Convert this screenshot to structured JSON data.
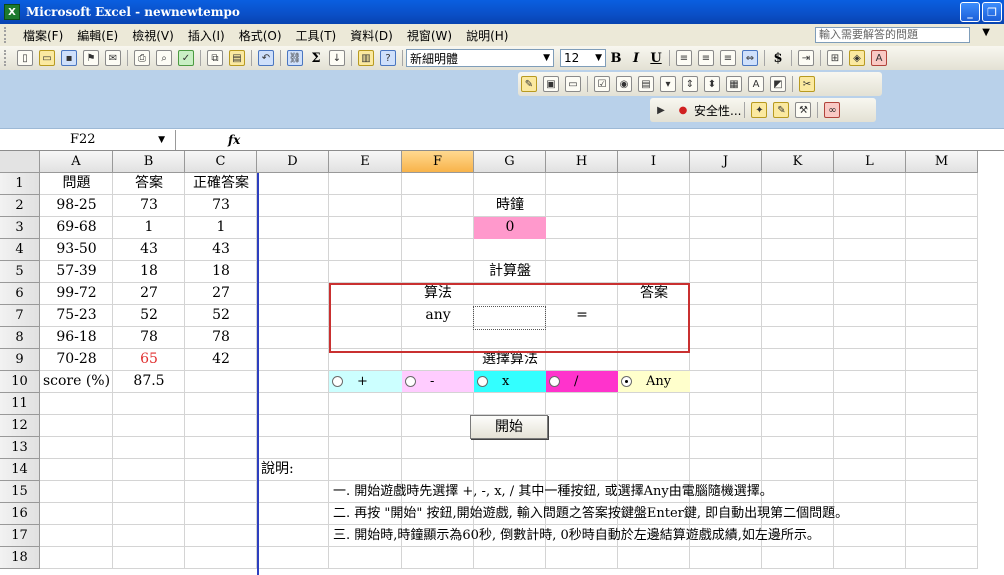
{
  "window": {
    "title": "Microsoft Excel - newnewtempo",
    "app_icon": "X"
  },
  "menu": {
    "items": [
      "檔案(F)",
      "編輯(E)",
      "檢視(V)",
      "插入(I)",
      "格式(O)",
      "工具(T)",
      "資料(D)",
      "視窗(W)",
      "說明(H)"
    ],
    "help_placeholder": "輸入需要解答的問題"
  },
  "toolbar": {
    "font_name": "新細明體",
    "font_size": "12",
    "bold": "B",
    "italic": "I",
    "underline": "U",
    "sum": "Σ",
    "currency": "$",
    "security_label": "安全性..."
  },
  "formula_bar": {
    "name_box": "F22",
    "fx": "fx"
  },
  "grid": {
    "columns": [
      "A",
      "B",
      "C",
      "D",
      "E",
      "F",
      "G",
      "H",
      "I",
      "J",
      "K",
      "L",
      "M"
    ],
    "selected_column": "F",
    "rows": [
      "1",
      "2",
      "3",
      "4",
      "5",
      "6",
      "7",
      "8",
      "9",
      "10",
      "11",
      "12",
      "13",
      "14",
      "15",
      "16",
      "17",
      "18"
    ]
  },
  "table": {
    "headers": [
      "問題",
      "答案",
      "正確答案"
    ],
    "rows": [
      [
        "98-25",
        "73",
        "73"
      ],
      [
        "69-68",
        "1",
        "1"
      ],
      [
        "93-50",
        "43",
        "43"
      ],
      [
        "57-39",
        "18",
        "18"
      ],
      [
        "99-72",
        "27",
        "27"
      ],
      [
        "75-23",
        "52",
        "52"
      ],
      [
        "96-18",
        "78",
        "78"
      ],
      [
        "70-28",
        "65",
        "42"
      ]
    ],
    "wrong_answer_color": "#e03030",
    "score_label": "score (%)",
    "score_value": "87.5"
  },
  "clock": {
    "label": "時鐘",
    "value": "0",
    "color": "#ff99cc"
  },
  "calculator": {
    "label": "計算盤",
    "method_label": "算法",
    "answer_label": "答案",
    "method_value": "any",
    "equals": "="
  },
  "operators": {
    "label": "選擇算法",
    "options": [
      {
        "label": "+",
        "color": "#ccffff"
      },
      {
        "label": "-",
        "color": "#ffccff"
      },
      {
        "label": "x",
        "color": "#33ffff"
      },
      {
        "label": "/",
        "color": "#ff33cc"
      },
      {
        "label": "Any",
        "color": "#ffffcc",
        "selected": true
      }
    ]
  },
  "start_button": "開始",
  "instructions": {
    "heading": "說明:",
    "lines": [
      "一.  開始遊戲時先選擇  +,   -,  x,  / 其中一種按鈕,  或選擇Any由電腦隨機選擇。",
      "二.  再按 \"開始\" 按鈕,開始遊戲,  輸入問題之答案按鍵盤Enter鍵,  即自動出現第二個問題。",
      "三.  開始時,時鐘顯示為60秒,  倒數計時,  0秒時自動於左邊結算遊戲成績,如左邊所示。"
    ]
  }
}
